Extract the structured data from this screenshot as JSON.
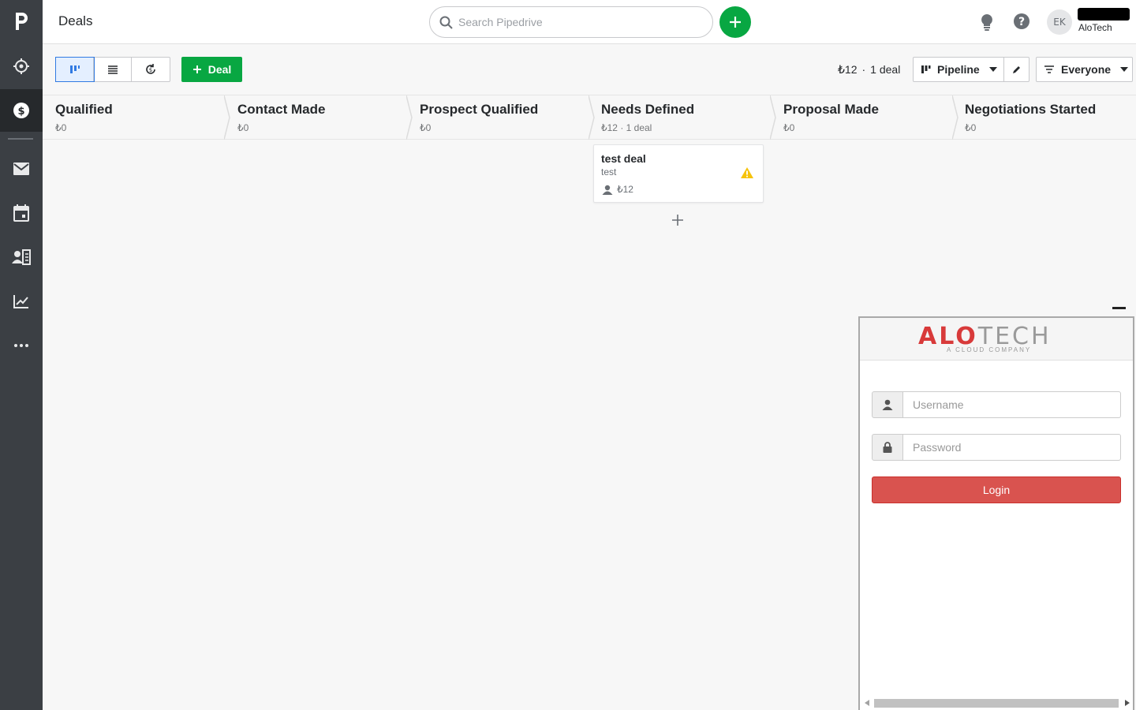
{
  "app": {
    "name": "Pipedrive",
    "page_title": "Deals"
  },
  "sidebar": {
    "items": [
      {
        "name": "logo",
        "icon": "pipedrive-logo-icon"
      },
      {
        "name": "leads",
        "icon": "target-icon"
      },
      {
        "name": "deals",
        "icon": "dollar-icon",
        "active": true
      },
      {
        "name": "mail",
        "icon": "mail-icon"
      },
      {
        "name": "activities",
        "icon": "calendar-icon"
      },
      {
        "name": "contacts",
        "icon": "contacts-icon"
      },
      {
        "name": "insights",
        "icon": "chart-icon"
      },
      {
        "name": "more",
        "icon": "more-icon"
      }
    ]
  },
  "header": {
    "search_placeholder": "Search Pipedrive",
    "avatar_initials": "EK",
    "company": "AloTech"
  },
  "toolbar": {
    "views": [
      "pipeline-view",
      "list-view",
      "forecast-view"
    ],
    "active_view": "pipeline-view",
    "add_deal_label": "Deal",
    "summary_value": "₺12",
    "summary_count": "1 deal",
    "pipeline_label": "Pipeline",
    "filter_label": "Everyone"
  },
  "stages": [
    {
      "name": "Qualified",
      "meta": "₺0"
    },
    {
      "name": "Contact Made",
      "meta": "₺0"
    },
    {
      "name": "Prospect Qualified",
      "meta": "₺0"
    },
    {
      "name": "Needs Defined",
      "meta": "₺12 · 1 deal"
    },
    {
      "name": "Proposal Made",
      "meta": "₺0"
    },
    {
      "name": "Negotiations Started",
      "meta": "₺0"
    }
  ],
  "deal_card": {
    "title": "test deal",
    "organization": "test",
    "value": "₺12",
    "status_icon": "warning-icon",
    "stage": "Needs Defined"
  },
  "alotech_widget": {
    "logo_text_a": "ALO",
    "logo_text_b": "TECH",
    "logo_tagline": "A CLOUD COMPANY",
    "username_placeholder": "Username",
    "password_placeholder": "Password",
    "login_label": "Login"
  },
  "colors": {
    "sidebar_bg": "#3b3f44",
    "primary_green": "#08a742",
    "login_red": "#d9534f",
    "warning_yellow": "#f6c30b"
  }
}
